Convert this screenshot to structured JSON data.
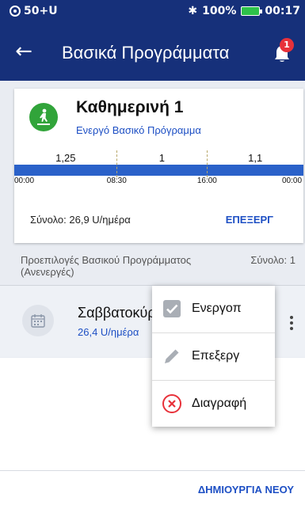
{
  "status_bar": {
    "carrier": "50+U",
    "battery_percent": "100%",
    "time": "00:17",
    "icons": [
      "signal-dot-icon",
      "bluetooth-icon",
      "battery-icon"
    ],
    "battery_color": "#2ec24a"
  },
  "app_bar": {
    "title": "Βασικά Προγράμματα",
    "notification_count": "1",
    "icons": [
      "back-arrow-icon",
      "bell-icon"
    ],
    "background": "#16307a"
  },
  "active_program": {
    "name": "Καθημερινή 1",
    "status": "Ενεργό Βασικό Πρόγραμμα",
    "icon": "walking-person-icon",
    "icon_color": "#31a43a",
    "total": "Σύνολο: 26,9 U/ημέρα",
    "edit_label": "ΕΠΕΞΕΡΓ"
  },
  "chart_data": {
    "type": "bar",
    "x_ticks": [
      "00:00",
      "08:30",
      "16:00",
      "00:00"
    ],
    "segments": [
      {
        "start": "00:00",
        "end": "08:30",
        "value": 1.25,
        "label": "1,25"
      },
      {
        "start": "08:30",
        "end": "16:00",
        "value": 1,
        "label": "1"
      },
      {
        "start": "16:00",
        "end": "24:00",
        "value": 1.1,
        "label": "1,1"
      }
    ],
    "bar_color": "#2a61c9"
  },
  "saved_section": {
    "title": "Προεπιλογές Βασικού Προγράμματος (Ανενεργές)",
    "count": "Σύνολο: 1"
  },
  "saved_items": [
    {
      "name": "Σαββατοκύριακο",
      "total": "26,4 U/ημέρα",
      "icon": "calendar-icon"
    }
  ],
  "context_menu": [
    {
      "label": "Ενεργοπ",
      "icon": "checkbox-icon"
    },
    {
      "label": "Επεξεργ",
      "icon": "pencil-icon"
    },
    {
      "label": "Διαγραφή",
      "icon": "delete-circle-icon",
      "icon_color": "#e8313a"
    }
  ],
  "footer": {
    "create_new_label": "ΔΗΜΙΟΥΡΓΙΑ ΝΕΟΥ"
  }
}
